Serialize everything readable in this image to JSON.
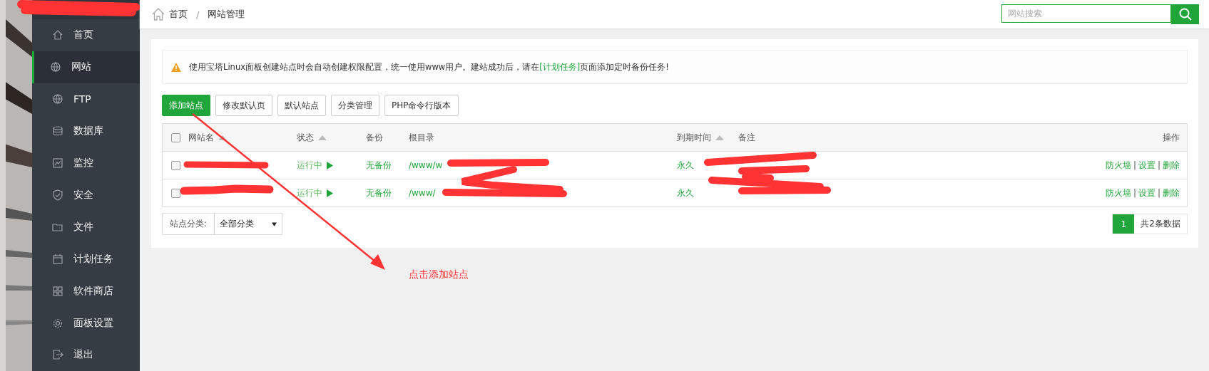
{
  "sidebar": {
    "items": [
      {
        "label": "首页",
        "selected": false
      },
      {
        "label": "网站",
        "selected": true
      },
      {
        "label": "FTP",
        "selected": false
      },
      {
        "label": "数据库",
        "selected": false
      },
      {
        "label": "监控",
        "selected": false
      },
      {
        "label": "安全",
        "selected": false
      },
      {
        "label": "文件",
        "selected": false
      },
      {
        "label": "计划任务",
        "selected": false
      },
      {
        "label": "软件商店",
        "selected": false
      },
      {
        "label": "面板设置",
        "selected": false
      },
      {
        "label": "退出",
        "selected": false
      }
    ]
  },
  "breadcrumb": {
    "items": [
      "首页",
      "网站管理"
    ],
    "separator": "/"
  },
  "search": {
    "placeholder": "网站搜索"
  },
  "notice": {
    "before": "使用宝塔Linux面板创建站点时会自动创建权限配置，统一使用www用户。建站成功后，请在",
    "link": "[计划任务]",
    "after": "页面添加定时备份任务!"
  },
  "toolbar": [
    {
      "label": "添加站点",
      "kind": "primary"
    },
    {
      "label": "修改默认页",
      "kind": "default"
    },
    {
      "label": "默认站点",
      "kind": "default"
    },
    {
      "label": "分类管理",
      "kind": "default"
    },
    {
      "label": "PHP命令行版本",
      "kind": "default"
    }
  ],
  "table": {
    "select_all": {
      "checked": false
    },
    "action_separator": "|",
    "columns": [
      {
        "label": "网站名",
        "sortable": true
      },
      {
        "label": "状态",
        "sortable": true
      },
      {
        "label": "备份",
        "sortable": false
      },
      {
        "label": "根目录",
        "sortable": false
      },
      {
        "label": "到期时间",
        "sortable": true
      },
      {
        "label": "备注",
        "sortable": false
      },
      {
        "label": "操作",
        "sortable": false
      }
    ],
    "rows": [
      {
        "checked": false,
        "status": "运行中",
        "backup": "无备份",
        "root": "/www/w",
        "expiry": "永久",
        "actions": [
          "防火墙",
          "设置",
          "删除"
        ]
      },
      {
        "checked": false,
        "status": "运行中",
        "backup": "无备份",
        "root": "/www/",
        "expiry": "永久",
        "actions": [
          "防火墙",
          "设置",
          "删除"
        ]
      }
    ]
  },
  "filter": {
    "label": "站点分类:",
    "value": "全部分类"
  },
  "pagination": {
    "pages": [
      {
        "label": "1",
        "selected": true
      }
    ],
    "total": "共2条数据"
  },
  "annotation": {
    "text": "点击添加站点"
  }
}
